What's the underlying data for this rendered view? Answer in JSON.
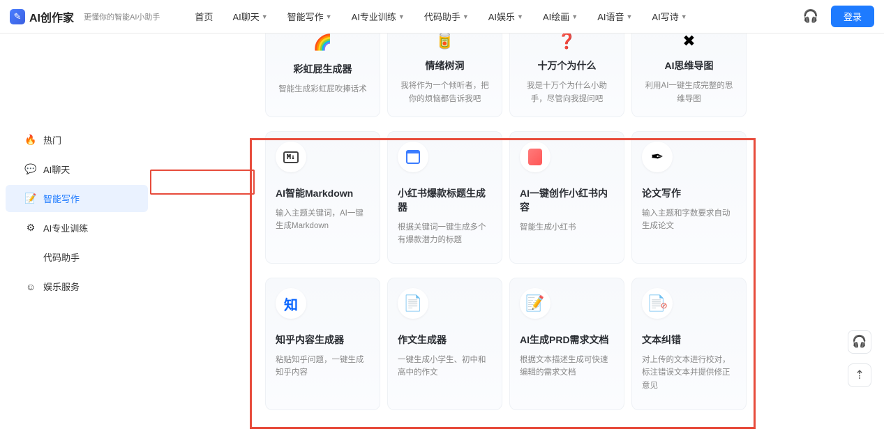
{
  "header": {
    "logo": "AI创作家",
    "slogan": "更懂你的智能AI小助手",
    "nav": [
      "首页",
      "AI聊天",
      "智能写作",
      "AI专业训练",
      "代码助手",
      "AI娱乐",
      "AI绘画",
      "AI语音",
      "AI写诗"
    ],
    "nav_has_chevron": [
      false,
      true,
      true,
      true,
      true,
      true,
      true,
      true,
      true
    ],
    "login": "登录"
  },
  "sidebar": {
    "items": [
      {
        "icon": "🔥",
        "label": "热门",
        "icon_name": "fire-icon"
      },
      {
        "icon": "💬",
        "label": "AI聊天",
        "icon_name": "chat-icon"
      },
      {
        "icon": "📝",
        "label": "智能写作",
        "icon_name": "write-icon",
        "active": true
      },
      {
        "icon": "⚙",
        "label": "AI专业训练",
        "icon_name": "gear-icon"
      },
      {
        "icon": "</>",
        "label": "代码助手",
        "icon_name": "code-icon"
      },
      {
        "icon": "☺",
        "label": "娱乐服务",
        "icon_name": "smile-icon"
      }
    ]
  },
  "cards_top": [
    {
      "title": "彩虹屁生成器",
      "desc": "智能生成彩虹屁吹捧话术",
      "emoji": "🌈"
    },
    {
      "title": "情绪树洞",
      "desc": "我将作为一个倾听者，把你的烦恼都告诉我吧",
      "emoji": "🥫"
    },
    {
      "title": "十万个为什么",
      "desc": "我是十万个为什么小助手，尽管向我提问吧",
      "emoji": "❓"
    },
    {
      "title": "AI思维导图",
      "desc": "利用AI一键生成完整的思维导图",
      "emoji": "✖"
    }
  ],
  "cards_mid": [
    {
      "title": "AI智能Markdown",
      "desc": "输入主题关键词，AI一键生成Markdown",
      "icon_type": "md"
    },
    {
      "title": "小红书爆款标题生成器",
      "desc": "根据关键词一键生成多个有爆款潜力的标题",
      "icon_type": "box"
    },
    {
      "title": "AI一键创作小红书内容",
      "desc": "智能生成小红书",
      "icon_type": "note"
    },
    {
      "title": "论文写作",
      "desc": "输入主题和字数要求自动生成论文",
      "icon_type": "pen"
    }
  ],
  "cards_bot": [
    {
      "title": "知乎内容生成器",
      "desc": "粘贴知乎问题，一键生成知乎内容",
      "icon_type": "zhi"
    },
    {
      "title": "作文生成器",
      "desc": "一键生成小学生、初中和高中的作文",
      "icon_type": "doc"
    },
    {
      "title": "AI生成PRD需求文档",
      "desc": "根据文本描述生成可快速编辑的需求文档",
      "icon_type": "doc2"
    },
    {
      "title": "文本纠错",
      "desc": "对上传的文本进行校对，标注错误文本并提供修正意见",
      "icon_type": "doc3"
    }
  ]
}
